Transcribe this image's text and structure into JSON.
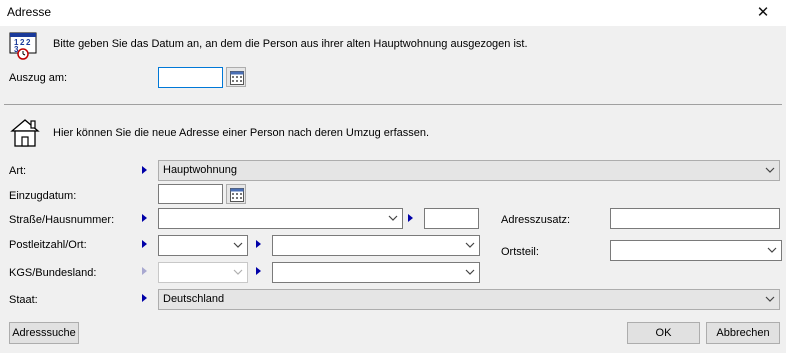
{
  "window": {
    "title": "Adresse",
    "close_glyph": "✕"
  },
  "moveout": {
    "info": "Bitte geben Sie das Datum an, an dem die Person aus ihrer alten Hauptwohnung ausgezogen ist.",
    "icon": "calendar-clock-icon",
    "date_label": "Auszug am:",
    "date_value": ""
  },
  "address": {
    "info": "Hier können Sie die neue Adresse einer Person nach deren Umzug erfassen.",
    "icon": "house-icon",
    "art": {
      "label": "Art:",
      "value": "Hauptwohnung"
    },
    "einzug": {
      "label": "Einzugdatum:",
      "value": ""
    },
    "strasse": {
      "label": "Straße/Hausnummer:",
      "street": "",
      "number": ""
    },
    "adresszusatz": {
      "label": "Adresszusatz:",
      "value": ""
    },
    "plz": {
      "label": "Postleitzahl/Ort:",
      "plz": "",
      "ort": ""
    },
    "ortsteil": {
      "label": "Ortsteil:",
      "value": ""
    },
    "kgs": {
      "label": "KGS/Bundesland:",
      "kgs": "",
      "bundesland": ""
    },
    "staat": {
      "label": "Staat:",
      "value": "Deutschland"
    }
  },
  "buttons": {
    "search": "Adresssuche",
    "ok": "OK",
    "cancel": "Abbrechen"
  },
  "colors": {
    "accent": "#0078d7",
    "arrow": "#0000a8",
    "background": "#f0f0f0"
  }
}
